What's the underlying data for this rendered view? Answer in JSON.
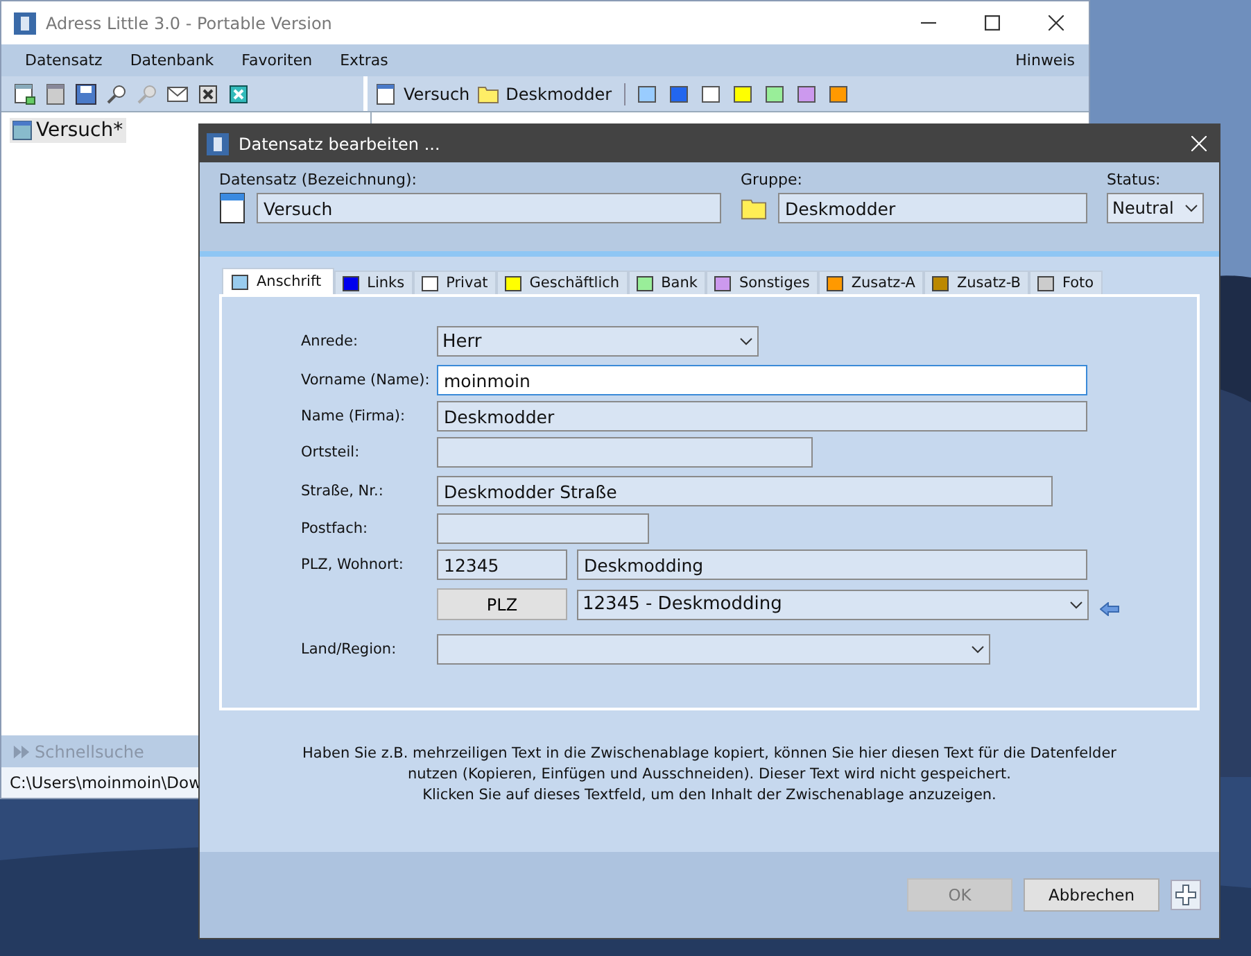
{
  "main_window": {
    "title": "Adress Little 3.0 - Portable Version",
    "menu": [
      {
        "label": "Datensatz"
      },
      {
        "label": "Datenbank"
      },
      {
        "label": "Favoriten"
      },
      {
        "label": "Extras"
      }
    ],
    "menu_right": "Hinweis",
    "toolbar": {
      "record": "Versuch",
      "group": "Deskmodder"
    },
    "swatches": [
      {
        "color": "#99ccff"
      },
      {
        "color": "#2266ee"
      },
      {
        "color": "#ffffff"
      },
      {
        "color": "#ffff00"
      },
      {
        "color": "#99ee99"
      },
      {
        "color": "#cc99ee"
      },
      {
        "color": "#ff9900"
      }
    ],
    "tree": [
      {
        "label": "Versuch*",
        "selected": true
      }
    ],
    "quick_search": "Schnellsuche",
    "path": "C:\\Users\\moinmoin\\Dow"
  },
  "dialog": {
    "title": "Datensatz bearbeiten ...",
    "record_label": "Datensatz (Bezeichnung):",
    "record_value": "Versuch",
    "group_label": "Gruppe:",
    "group_value": "Deskmodder",
    "status_label": "Status:",
    "status_value": "Neutral",
    "tabs": [
      {
        "label": "Anschrift",
        "color": "#99ccee",
        "selected": true
      },
      {
        "label": "Links",
        "color": "#0000ee",
        "selected": false
      },
      {
        "label": "Privat",
        "color": "#ffffff",
        "selected": false
      },
      {
        "label": "Geschäftlich",
        "color": "#ffff00",
        "selected": false
      },
      {
        "label": "Bank",
        "color": "#99ee99",
        "selected": false
      },
      {
        "label": "Sonstiges",
        "color": "#cc99ee",
        "selected": false
      },
      {
        "label": "Zusatz-A",
        "color": "#ff9900",
        "selected": false
      },
      {
        "label": "Zusatz-B",
        "color": "#bb8800",
        "selected": false
      },
      {
        "label": "Foto",
        "color": "#cccccc",
        "selected": false
      }
    ],
    "fields": [
      {
        "kind": "combo",
        "label": "Anrede:",
        "value": "Herr",
        "focused": false
      },
      {
        "kind": "text",
        "label": "Vorname (Name):",
        "value": "moinmoin",
        "focused": true
      },
      {
        "kind": "text",
        "label": "Name (Firma):",
        "value": "Deskmodder",
        "focused": false
      },
      {
        "kind": "text",
        "label": "Ortsteil:",
        "focused": false
      },
      {
        "kind": "text",
        "label": "Straße, Nr.:",
        "value": "Deskmodder Straße",
        "focused": false
      },
      {
        "kind": "text",
        "label": "Postfach:",
        "focused": false
      },
      {
        "kind": "zip_city",
        "label": "PLZ, Wohnort:",
        "zip": "12345",
        "city": "Deskmodding",
        "focused": false
      },
      {
        "kind": "zip_lookup",
        "button": "PLZ",
        "value": "12345 - Deskmodding",
        "focused": false
      },
      {
        "kind": "combo",
        "label": "Land/Region:",
        "focused": false
      }
    ],
    "hint_lines": [
      "Haben Sie z.B. mehrzeiligen Text in die Zwischenablage kopiert, können Sie hier diesen Text für die Datenfelder",
      "nutzen (Kopieren, Einfügen und Ausschneiden). Dieser Text wird nicht gespeichert.",
      "Klicken Sie auf dieses Textfeld, um den Inhalt der Zwischenablage anzuzeigen."
    ],
    "buttons": [
      {
        "label": "OK",
        "disabled": true
      },
      {
        "label": "Abbrechen",
        "disabled": false
      }
    ]
  }
}
